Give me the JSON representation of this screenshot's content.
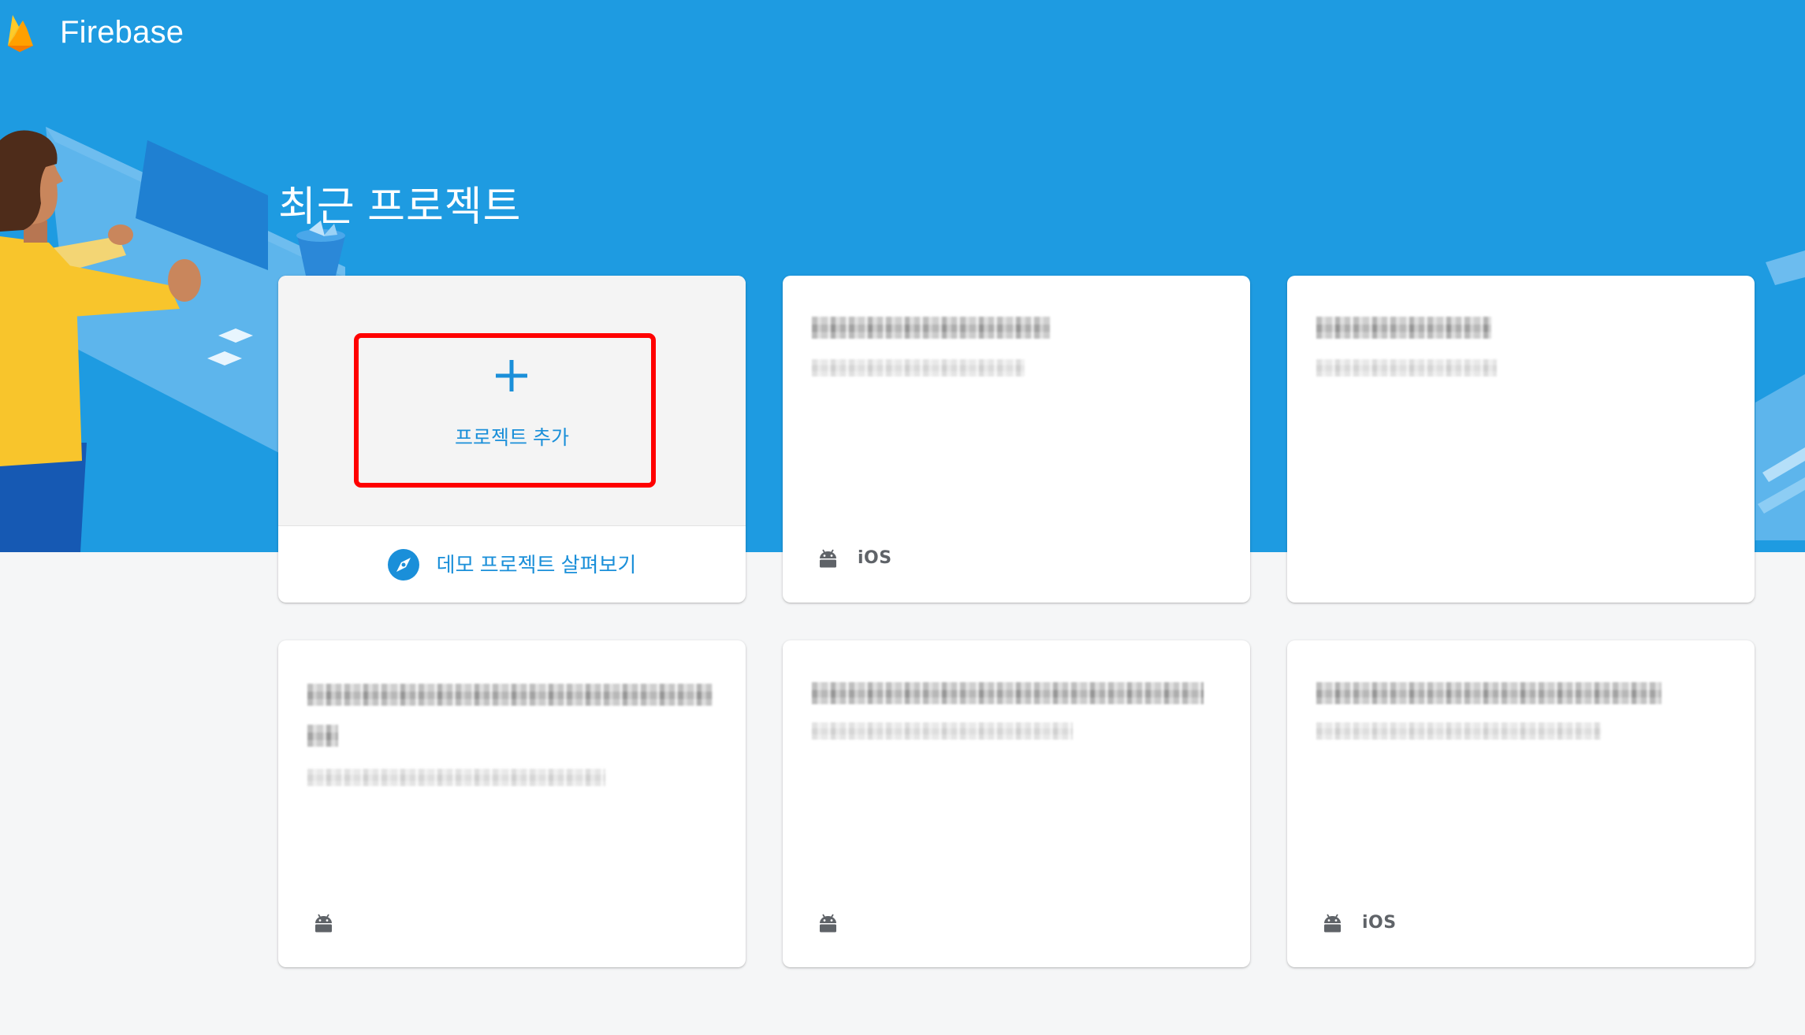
{
  "app": {
    "name": "Firebase",
    "logo_icon": "firebase-flame-icon"
  },
  "page": {
    "title": "최근 프로젝트"
  },
  "add_project": {
    "label": "프로젝트 추가",
    "icon": "plus-icon"
  },
  "demo_link": {
    "label": "데모 프로젝트 살펴보기",
    "icon": "compass-icon"
  },
  "projects": [
    {
      "platforms": [
        "android-icon",
        "iOS"
      ]
    },
    {
      "platforms": []
    },
    {
      "platforms": [
        "android-icon"
      ]
    },
    {
      "platforms": [
        "android-icon"
      ]
    },
    {
      "platforms": [
        "android-icon",
        "iOS"
      ]
    }
  ],
  "colors": {
    "header_blue": "#1e9be1",
    "accent_blue": "#1a8fd9",
    "highlight_red": "#ff0000",
    "page_bg": "#f5f6f7",
    "icon_gray": "#5f6368"
  }
}
